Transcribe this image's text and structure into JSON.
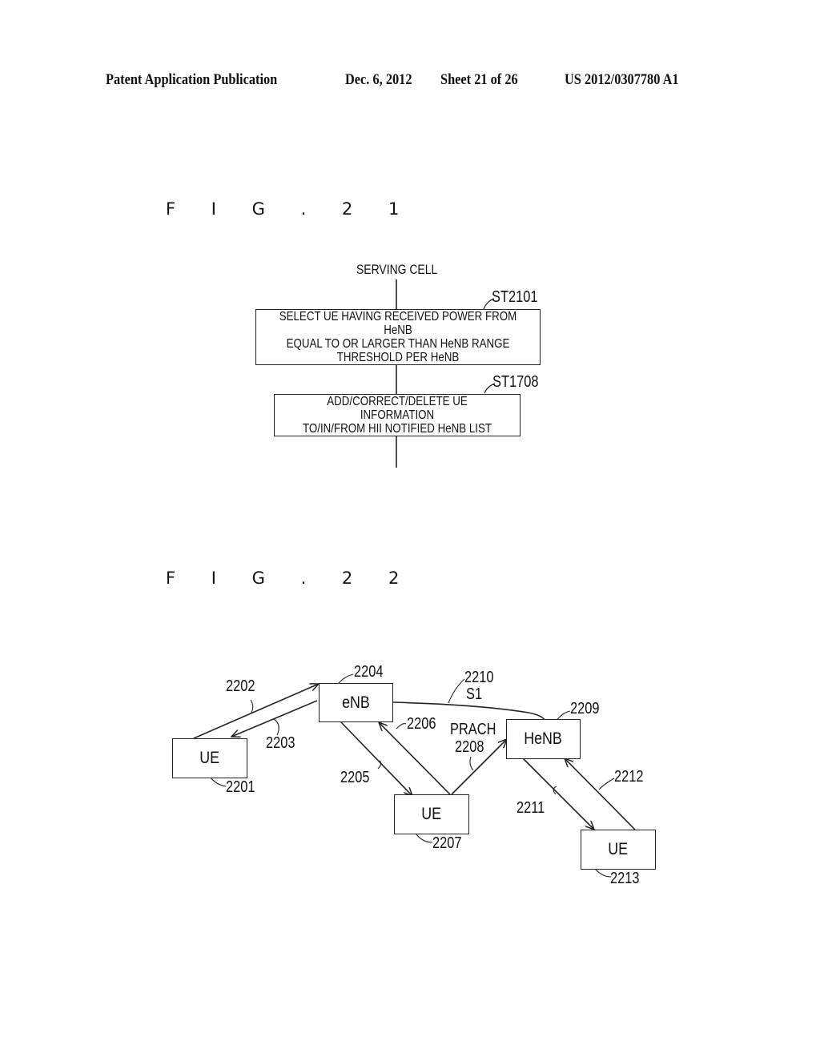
{
  "header": {
    "publication": "Patent Application Publication",
    "date": "Dec. 6, 2012",
    "sheet": "Sheet 21 of 26",
    "number": "US 2012/0307780 A1"
  },
  "fig21": {
    "title": "F I G . 2 1",
    "start_label": "SERVING CELL",
    "steps": [
      {
        "id": "ST2101",
        "lines": [
          "SELECT UE HAVING RECEIVED POWER FROM HeNB",
          "EQUAL TO OR LARGER THAN HeNB RANGE",
          "THRESHOLD PER HeNB"
        ]
      },
      {
        "id": "ST1708",
        "lines": [
          "ADD/CORRECT/DELETE UE INFORMATION",
          "TO/IN/FROM HII NOTIFIED HeNB LIST"
        ]
      }
    ]
  },
  "fig22": {
    "title": "F I G . 2 2",
    "nodes": {
      "ue_2201": {
        "label": "UE",
        "ref": "2201"
      },
      "enb_2204": {
        "label": "eNB",
        "ref": "2204"
      },
      "ue_2207": {
        "label": "UE",
        "ref": "2207"
      },
      "henb_2209": {
        "label": "HeNB",
        "ref": "2209"
      },
      "ue_2213": {
        "label": "UE",
        "ref": "2213"
      }
    },
    "links": {
      "l2202": "2202",
      "l2203": "2203",
      "l2205": "2205",
      "l2206": "2206",
      "l2208_name": "PRACH",
      "l2208": "2208",
      "l2210": "2210",
      "l2210_name": "S1",
      "l2211": "2211",
      "l2212": "2212"
    }
  }
}
